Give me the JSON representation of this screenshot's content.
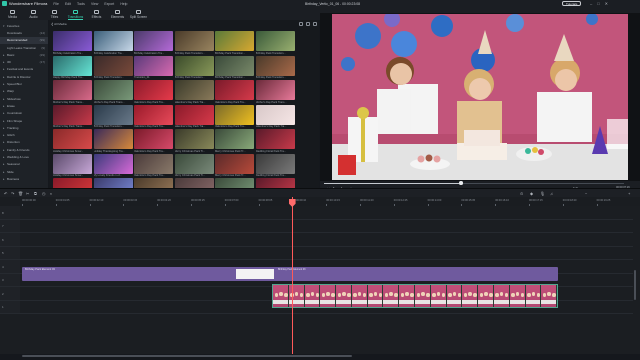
{
  "app": {
    "name": "Wondershare Filmora",
    "menu": [
      "File",
      "Edit",
      "Tools",
      "View",
      "Export",
      "Help"
    ],
    "project_title": "Birthday_Vertic_01_06 - 00:00:23:08",
    "tutorial_label": "Tutorials",
    "window_buttons": [
      "–",
      "□",
      "✕"
    ]
  },
  "tabs": [
    "Media",
    "Audio",
    "Titles",
    "Transitions",
    "Effects",
    "Elements",
    "Split Screen"
  ],
  "active_tab": "Transitions",
  "sidebar": [
    {
      "label": "Favorites",
      "count": "",
      "caret": "▾"
    },
    {
      "label": "Downloads",
      "count": "(14)",
      "caret": ""
    },
    {
      "label": "Recommended",
      "count": "(99)",
      "caret": "",
      "selected": true
    },
    {
      "label": "Light Leaks Transition",
      "count": "(9)",
      "caret": ""
    },
    {
      "label": "Basic",
      "count": "(29)",
      "caret": "▸"
    },
    {
      "label": "3D",
      "count": "(17)",
      "caret": "▸"
    },
    {
      "label": "Festival and Events",
      "count": "",
      "caret": "▸"
    },
    {
      "label": "Dazzle & Discolor",
      "count": "",
      "caret": "▸"
    },
    {
      "label": "Speed Blur",
      "count": "",
      "caret": "▸"
    },
    {
      "label": "Warp",
      "count": "",
      "caret": "▸"
    },
    {
      "label": "Slideshow",
      "count": "",
      "caret": "▸"
    },
    {
      "label": "Erase",
      "count": "",
      "caret": "▸"
    },
    {
      "label": "Countdown",
      "count": "",
      "caret": "▸"
    },
    {
      "label": "Film Shape",
      "count": "",
      "caret": "▸"
    },
    {
      "label": "Tracking",
      "count": "",
      "caret": "▸"
    },
    {
      "label": "Glitch",
      "count": "",
      "caret": "▸"
    },
    {
      "label": "Distortion",
      "count": "",
      "caret": "▸"
    },
    {
      "label": "Family & Friends",
      "count": "",
      "caret": "▸"
    },
    {
      "label": "Wedding & Love",
      "count": "",
      "caret": "▸"
    },
    {
      "label": "Seasonal",
      "count": "",
      "caret": "▸"
    },
    {
      "label": "Slide",
      "count": "",
      "caret": "▸"
    },
    {
      "label": "Business",
      "count": "",
      "caret": "▸"
    }
  ],
  "gallery": {
    "breadcrumb": "❮  All Media",
    "thumbnails": [
      {
        "label": "Birthday Celebration Tra...",
        "c1": "#3a2d6b",
        "c2": "#8a5bd6"
      },
      {
        "label": "Birthday Celebration Tra...",
        "c1": "#3a5e7a",
        "c2": "#c8d8e8"
      },
      {
        "label": "Birthday Celebration Tra...",
        "c1": "#4a3a6a",
        "c2": "#b56ad8"
      },
      {
        "label": "Birthday Pack Transition...",
        "c1": "#4a3b2a",
        "c2": "#9a8560"
      },
      {
        "label": "Birthday Pack Transition...",
        "c1": "#5a7a3a",
        "c2": "#d8a830"
      },
      {
        "label": "Birthday Pack Transition...",
        "c1": "#3a5a3a",
        "c2": "#9ab070"
      },
      {
        "label": "Happy Birthday Pack Tra...",
        "c1": "#2a6a6a",
        "c2": "#66e6d6"
      },
      {
        "label": "Birthday Pack Transition...",
        "c1": "#3a2a2a",
        "c2": "#7a4a3a"
      },
      {
        "label": "Transition_01",
        "c1": "#5a3a7a",
        "c2": "#d86ab0"
      },
      {
        "label": "Birthday Pack Transition...",
        "c1": "#3a4a2a",
        "c2": "#8a9a5a"
      },
      {
        "label": "Birthday Pack Transition...",
        "c1": "#3a4a3a",
        "c2": "#7a8a6a"
      },
      {
        "label": "Birthday Pack Transition...",
        "c1": "#4a3a2a",
        "c2": "#aa6a4a"
      },
      {
        "label": "Mother's Day Pack Trans...",
        "c1": "#6a2a3a",
        "c2": "#d86a8a"
      },
      {
        "label": "Mother's Day Pack Trans...",
        "c1": "#3a4a3a",
        "c2": "#7a9a7a"
      },
      {
        "label": "Valentine's Day Pack Tra...",
        "c1": "#8a1a2a",
        "c2": "#e63a4a"
      },
      {
        "label": "Valentine's Day Pack Tra...",
        "c1": "#3a3a2a",
        "c2": "#8a7a5a"
      },
      {
        "label": "Valentine's Day Pack Tra...",
        "c1": "#7a1a2a",
        "c2": "#d63a4a"
      },
      {
        "label": "Mother's Day Pack Trans...",
        "c1": "#6a2a3a",
        "c2": "#e87a9a"
      },
      {
        "label": "Mother's Day Pack Trans...",
        "c1": "#5a1a2a",
        "c2": "#c83a4a"
      },
      {
        "label": "Birthday Pack Transition...",
        "c1": "#2a3a4a",
        "c2": "#6a7a8a"
      },
      {
        "label": "Valentine's Day Pack Tra...",
        "c1": "#9a1a2a",
        "c2": "#e84a5a"
      },
      {
        "label": "Valentine's Day Pack Tra...",
        "c1": "#8a1a2a",
        "c2": "#d83a4a"
      },
      {
        "label": "Valentine's Day Pack Tra...",
        "c1": "#7a6a2a",
        "c2": "#f0c020"
      },
      {
        "label": "Valentine's Day Pack Tra...",
        "c1": "#d8c8c8",
        "c2": "#f6e6e6"
      },
      {
        "label": "Holiday Christmas Snow...",
        "c1": "#8a2a2a",
        "c2": "#d84a4a"
      },
      {
        "label": "Holiday Thanksgiving Tra...",
        "c1": "#3a2a5a",
        "c2": "#d88a3a"
      },
      {
        "label": "Valentine's Day Pack Tra...",
        "c1": "#7a1a2a",
        "c2": "#d84a6a"
      },
      {
        "label": "Merry Christmas Pack Tr...",
        "c1": "#3a3a2a",
        "c2": "#8a8a5a"
      },
      {
        "label": "Merry Christmas Pack Tr...",
        "c1": "#3a4a3a",
        "c2": "#8aaa7a"
      },
      {
        "label": "Wedding Floral Pack Tra...",
        "c1": "#5a1a2a",
        "c2": "#c83a4a"
      },
      {
        "label": "Holiday Christmas Snow...",
        "c1": "#5a4a6a",
        "c2": "#c8a8d8"
      },
      {
        "label": "My Lovely Friends 1 of...",
        "c1": "#3a3a7a",
        "c2": "#d86ad8"
      },
      {
        "label": "Valentine's Day Pack Tra...",
        "c1": "#4a3a3a",
        "c2": "#8a7a6a"
      },
      {
        "label": "Merry Christmas Pack Tr...",
        "c1": "#3a4a3a",
        "c2": "#7a8a7a"
      },
      {
        "label": "Merry Christmas Pack Tr...",
        "c1": "#5a2a2a",
        "c2": "#b84a3a"
      },
      {
        "label": "Wedding Floral Pack Tra...",
        "c1": "#3a3a3a",
        "c2": "#7a7a7a"
      },
      {
        "label": "",
        "c1": "#8a1a2a",
        "c2": "#d83a3a"
      },
      {
        "label": "",
        "c1": "#3a3a6a",
        "c2": "#7a8ad8"
      },
      {
        "label": "",
        "c1": "#4a3a2a",
        "c2": "#9a7a5a"
      },
      {
        "label": "",
        "c1": "#4a3a3a",
        "c2": "#8a6a6a"
      },
      {
        "label": "",
        "c1": "#3a4a3a",
        "c2": "#7a9a7a"
      },
      {
        "label": "",
        "c1": "#5a1a2a",
        "c2": "#c83a4a"
      }
    ]
  },
  "preview": {
    "controls": [
      "⏮",
      "⏵",
      "▶",
      "■"
    ],
    "zoom_label": "Full",
    "time": "00:00:07:29"
  },
  "timeline": {
    "ruler_labels": [
      "00:00:00:00",
      "00:00:01:05",
      "00:00:02:10",
      "00:00:03:15",
      "00:00:04:20",
      "00:00:05:25",
      "00:00:07:00",
      "00:00:08:05",
      "00:00:09:10",
      "00:00:10:15",
      "00:00:11:20",
      "00:00:12:25",
      "00:00:14:00",
      "00:00:15:05",
      "00:00:16:10",
      "00:00:17:15",
      "00:00:18:20",
      "00:00:19:25"
    ],
    "track_labels": [
      "8",
      "7",
      "6",
      "5",
      "4",
      "3",
      "2",
      "1"
    ],
    "title_clip_label": "Birthday Pack Element 03",
    "title_clip_label2": "Birthday Pack Element 03",
    "video_clip_label": "Birthday_Vertic_01_06",
    "video_frame_count": 18
  },
  "colors": {
    "accent": "#39d3b4",
    "playhead": "#ff5a5a",
    "title_clip": "#6f5a9e",
    "video_clip": "#2f6b5a"
  }
}
